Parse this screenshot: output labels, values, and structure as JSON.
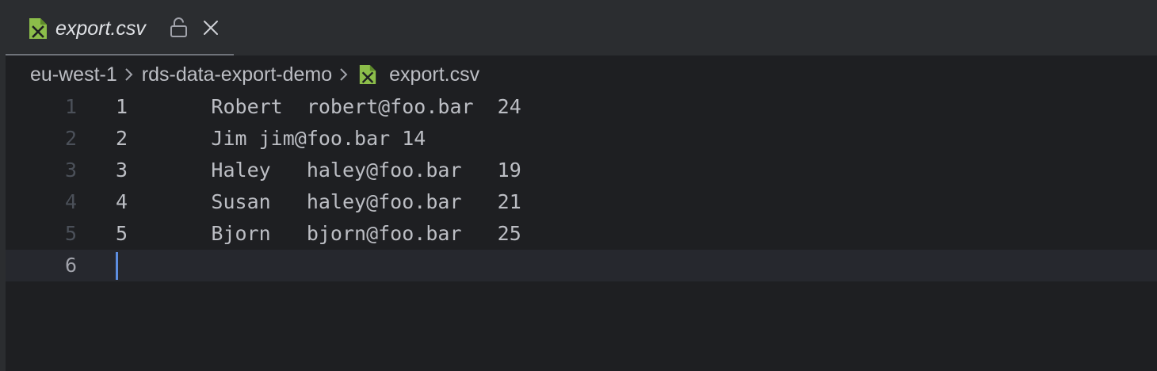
{
  "tab": {
    "title": "export.csv",
    "file_icon": "csv-file-icon",
    "lock_icon": "lock-icon",
    "close_icon": "close-icon"
  },
  "breadcrumb": {
    "items": [
      "eu-west-1",
      "rds-data-export-demo",
      "export.csv"
    ],
    "separator_icon": "chevron-right-icon",
    "file_icon": "csv-file-icon"
  },
  "editor": {
    "lines": [
      {
        "number": "1",
        "text": "1\tRobert\trobert@foo.bar\t24"
      },
      {
        "number": "2",
        "text": "2\tJim jim@foo.bar 14"
      },
      {
        "number": "3",
        "text": "3\tHaley\thaley@foo.bar\t19"
      },
      {
        "number": "4",
        "text": "4\tSusan\thaley@foo.bar\t21"
      },
      {
        "number": "5",
        "text": "5\tBjorn\tbjorn@foo.bar\t25"
      },
      {
        "number": "6",
        "text": ""
      }
    ],
    "current_line": 6
  },
  "colors": {
    "csv_icon_green": "#8cbd4a",
    "caret": "#5d8ee0",
    "text": "#bcbec4",
    "background": "#1e1f22"
  }
}
